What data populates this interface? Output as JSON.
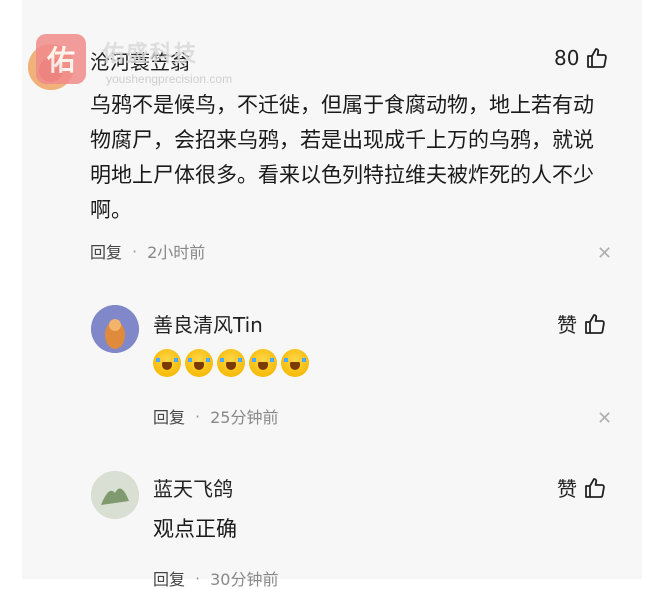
{
  "watermark": {
    "logo_char": "佑",
    "title": "佑盛科技",
    "url": "youshengprecision.com"
  },
  "comments": [
    {
      "author": "沧河蓑笠翁",
      "likes": "80",
      "text": "乌鸦不是候鸟，不迁徙，但属于食腐动物，地上若有动物腐尸，会招来乌鸦，若是出现成千上万的乌鸦，就说明地上尸体很多。看来以色列特拉维夫被炸死的人不少啊。",
      "reply_label": "回复",
      "separator": "·",
      "time": "2小时前"
    },
    {
      "author": "善良清风Tin",
      "likes": "赞",
      "emoji_count": 5,
      "reply_label": "回复",
      "separator": "·",
      "time": "25分钟前"
    },
    {
      "author": "蓝天飞鸽",
      "likes": "赞",
      "text": "观点正确",
      "reply_label": "回复",
      "separator": "·",
      "time": "30分钟前"
    }
  ],
  "icons": {
    "like": "thumbs-up-icon",
    "close": "close-icon"
  },
  "colors": {
    "background": "#f7f7f7",
    "watermark_logo": "#f28b8b"
  }
}
